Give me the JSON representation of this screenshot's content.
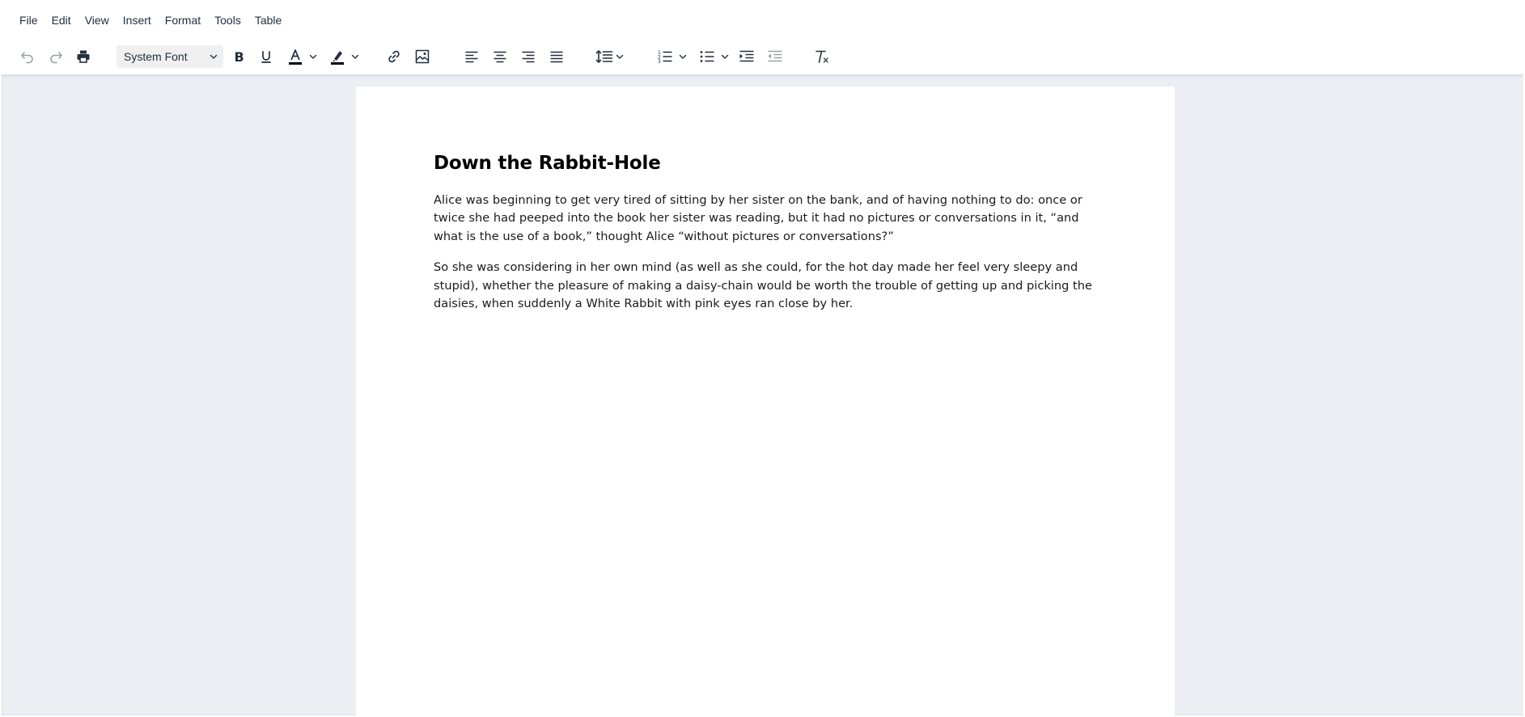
{
  "menubar": {
    "items": [
      "File",
      "Edit",
      "View",
      "Insert",
      "Format",
      "Tools",
      "Table"
    ]
  },
  "toolbar": {
    "font_family": "System Font",
    "icons": {
      "undo": "undo-icon",
      "redo": "redo-icon",
      "print": "print-icon",
      "bold": "bold-icon",
      "underline": "underline-icon",
      "text_color": "text-color-icon",
      "highlight": "highlight-icon",
      "link": "link-icon",
      "image": "image-icon",
      "align_left": "align-left-icon",
      "align_center": "align-center-icon",
      "align_right": "align-right-icon",
      "align_justify": "align-justify-icon",
      "line_height": "line-height-icon",
      "numbered_list": "numbered-list-icon",
      "bullet_list": "bullet-list-icon",
      "indent": "indent-icon",
      "outdent": "outdent-icon",
      "clear_formatting": "clear-formatting-icon"
    },
    "colors": {
      "text_color_swatch": "#000000",
      "highlight_swatch": "#000000"
    }
  },
  "document": {
    "title": "Down the Rabbit-Hole",
    "paragraphs": [
      "Alice was beginning to get very tired of sitting by her sister on the bank, and of having nothing to do: once or twice she had peeped into the book her sister was reading, but it had no pictures or conversations in it, “and what is the use of a book,” thought Alice “without pictures or conversations?”",
      "So she was considering in her own mind (as well as she could, for the hot day made her feel very sleepy and stupid), whether the pleasure of making a daisy-chain would be worth the trouble of getting up and picking the daisies, when suddenly a White Rabbit with pink eyes ran close by her."
    ]
  },
  "colors": {
    "canvas_background": "#eceef3",
    "page_background": "#ffffff",
    "icon_color": "#222f3e",
    "disabled_icon_color": "#9aa0a6"
  }
}
